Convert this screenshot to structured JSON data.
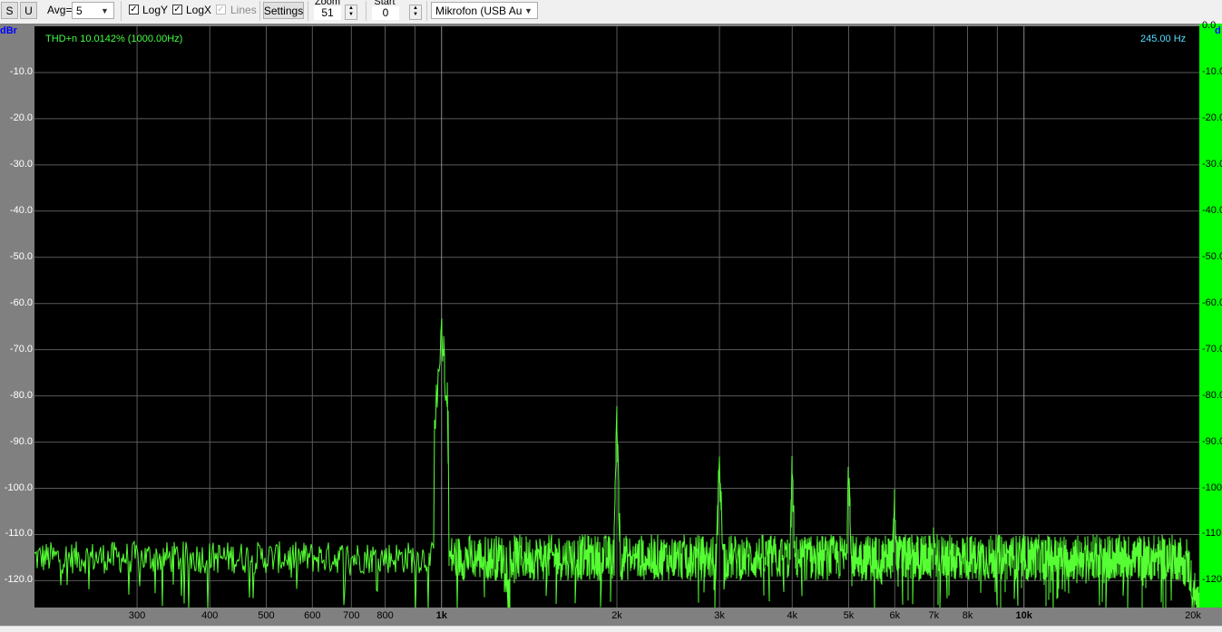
{
  "toolbar": {
    "s_label": "S",
    "u_label": "U",
    "avg_label": "Avg=",
    "avg_value": "5",
    "logy_label": "LogY",
    "logx_label": "LogX",
    "lines_label": "Lines",
    "settings_label": "Settings",
    "zoom_label": "Zoom",
    "zoom_value": "51",
    "start_label": "Start",
    "start_value": "0",
    "device_value": "Mikrofon (USB Audio"
  },
  "plot": {
    "unit_left": "dBr",
    "unit_right": "d",
    "thd_text": "THD+n 10.0142% (1000.00Hz)",
    "cursor_freq": "245.00 Hz",
    "colors": {
      "trace": "#55ff33",
      "grid": "#5a5a5a",
      "background": "#000000",
      "thd_text": "#44ff44",
      "cursor_text": "#55ddff"
    }
  },
  "chart_data": {
    "type": "line",
    "x_scale": "log",
    "y_unit": "dBr",
    "xlim": [
      200,
      20000
    ],
    "ylim": [
      -126,
      0
    ],
    "y_ticks_left": [
      "-10.0",
      "-20.0",
      "-30.0",
      "-40.0",
      "-50.0",
      "-60.0",
      "-70.0",
      "-80.0",
      "-90.0",
      "-100.0",
      "-110.0",
      "-120.0"
    ],
    "y_ticks_right": [
      "0.0",
      "-10.0",
      "-20.0",
      "-30.0",
      "-40.0",
      "-50.0",
      "-60.0",
      "-70.0",
      "-80.0",
      "-90.0",
      "-100.0",
      "-110.0",
      "-120.0"
    ],
    "x_ticks": [
      {
        "label": "300",
        "value": 300,
        "major": false
      },
      {
        "label": "400",
        "value": 400,
        "major": false
      },
      {
        "label": "500",
        "value": 500,
        "major": false
      },
      {
        "label": "600",
        "value": 600,
        "major": false
      },
      {
        "label": "700",
        "value": 700,
        "major": false
      },
      {
        "label": "800",
        "value": 800,
        "major": false
      },
      {
        "label": "1k",
        "value": 1000,
        "major": true
      },
      {
        "label": "2k",
        "value": 2000,
        "major": false
      },
      {
        "label": "3k",
        "value": 3000,
        "major": false
      },
      {
        "label": "4k",
        "value": 4000,
        "major": false
      },
      {
        "label": "5k",
        "value": 5000,
        "major": false
      },
      {
        "label": "6k",
        "value": 6000,
        "major": false
      },
      {
        "label": "7k",
        "value": 7000,
        "major": false
      },
      {
        "label": "8k",
        "value": 8000,
        "major": false
      },
      {
        "label": "10k",
        "value": 10000,
        "major": true
      },
      {
        "label": "20k",
        "value": 20000,
        "major": false
      }
    ],
    "noise_floor_db": -115,
    "peaks": [
      {
        "freq": 1000,
        "db": -61
      },
      {
        "freq": 2000,
        "db": -82
      },
      {
        "freq": 3000,
        "db": -87
      },
      {
        "freq": 4000,
        "db": -91
      },
      {
        "freq": 5000,
        "db": -92
      },
      {
        "freq": 6000,
        "db": -97
      },
      {
        "freq": 7000,
        "db": -103
      }
    ],
    "rolloff_start_hz": 19000
  }
}
